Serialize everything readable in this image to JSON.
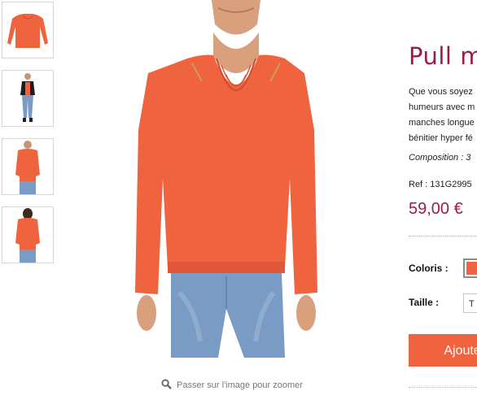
{
  "gallery": {
    "thumbnails": [
      "thumb-front",
      "thumb-full-outfit",
      "thumb-front-model",
      "thumb-back"
    ],
    "zoom_hint": "Passer sur l'image pour zoomer"
  },
  "product": {
    "title": "Pull m",
    "description_lines": [
      "Que vous soyez",
      "humeurs avec m",
      "manches longue",
      "bénitier hyper fé"
    ],
    "composition": "Composition : 3",
    "ref": "Ref : 131G2995",
    "price": "59,00 €",
    "color_label": "Coloris :",
    "size_label": "Taille :",
    "size_value": "T",
    "add_button": "Ajoute"
  },
  "colors": {
    "accent": "#9b1c4c",
    "product_color": "#f0633f",
    "button": "#f0633f"
  }
}
